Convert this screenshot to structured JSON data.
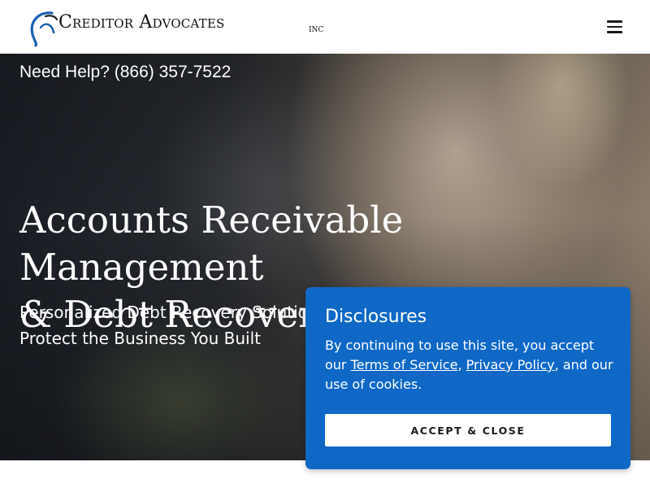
{
  "header": {
    "logo_text": "Creditor Advocates",
    "logo_suffix": "INC",
    "menu_icon": "hamburger-menu-icon"
  },
  "hero": {
    "phone": "Need Help? (866) 357-7522",
    "title_line1": "Accounts Receivable Management",
    "title_line2": "& Debt Recovery",
    "subtitle": "Personalized Debt Recovery Solutions to Protect the Business You Built"
  },
  "disclosure": {
    "title": "Disclosures",
    "text_before": "By continuing to use this site, you accept our ",
    "terms_link": "Terms of Service",
    "comma": ", ",
    "privacy_link": "Privacy Policy",
    "text_after": ", and our use of cookies.",
    "button_label": "ACCEPT & CLOSE"
  },
  "colors": {
    "panel_blue": "#0f68c6",
    "logo_blue": "#1a5fb4"
  }
}
